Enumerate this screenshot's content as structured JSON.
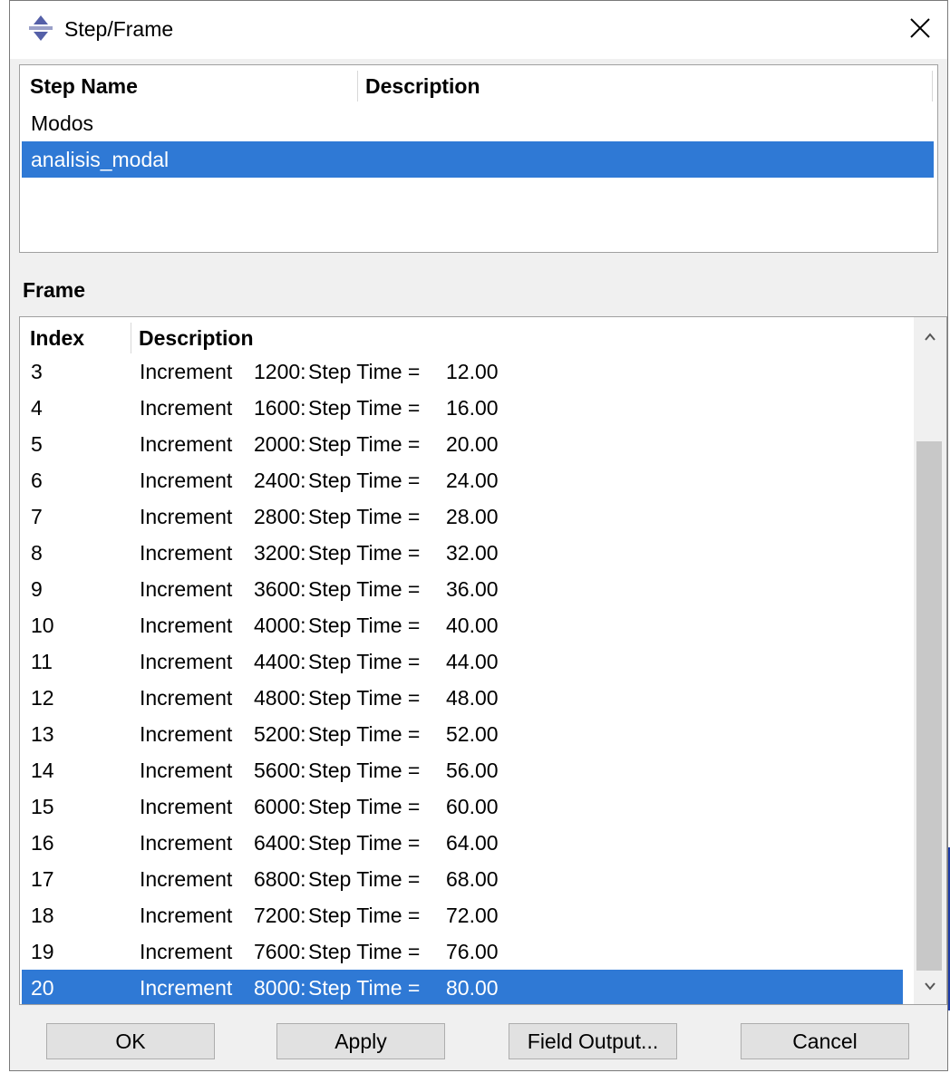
{
  "window": {
    "title": "Step/Frame"
  },
  "step_table": {
    "columns": [
      "Step Name",
      "Description"
    ],
    "rows": [
      {
        "name": "Modos",
        "description": ""
      },
      {
        "name": "analisis_modal",
        "description": ""
      }
    ],
    "selected_row": 1
  },
  "frame_section": {
    "label": "Frame",
    "columns": [
      "Index",
      "Description"
    ],
    "rows": [
      {
        "index": "3",
        "increment": "Increment",
        "number": "1200:",
        "step_time": "Step Time =",
        "value": "12.00"
      },
      {
        "index": "4",
        "increment": "Increment",
        "number": "1600:",
        "step_time": "Step Time =",
        "value": "16.00"
      },
      {
        "index": "5",
        "increment": "Increment",
        "number": "2000:",
        "step_time": "Step Time =",
        "value": "20.00"
      },
      {
        "index": "6",
        "increment": "Increment",
        "number": "2400:",
        "step_time": "Step Time =",
        "value": "24.00"
      },
      {
        "index": "7",
        "increment": "Increment",
        "number": "2800:",
        "step_time": "Step Time =",
        "value": "28.00"
      },
      {
        "index": "8",
        "increment": "Increment",
        "number": "3200:",
        "step_time": "Step Time =",
        "value": "32.00"
      },
      {
        "index": "9",
        "increment": "Increment",
        "number": "3600:",
        "step_time": "Step Time =",
        "value": "36.00"
      },
      {
        "index": "10",
        "increment": "Increment",
        "number": "4000:",
        "step_time": "Step Time =",
        "value": "40.00"
      },
      {
        "index": "11",
        "increment": "Increment",
        "number": "4400:",
        "step_time": "Step Time =",
        "value": "44.00"
      },
      {
        "index": "12",
        "increment": "Increment",
        "number": "4800:",
        "step_time": "Step Time =",
        "value": "48.00"
      },
      {
        "index": "13",
        "increment": "Increment",
        "number": "5200:",
        "step_time": "Step Time =",
        "value": "52.00"
      },
      {
        "index": "14",
        "increment": "Increment",
        "number": "5600:",
        "step_time": "Step Time =",
        "value": "56.00"
      },
      {
        "index": "15",
        "increment": "Increment",
        "number": "6000:",
        "step_time": "Step Time =",
        "value": "60.00"
      },
      {
        "index": "16",
        "increment": "Increment",
        "number": "6400:",
        "step_time": "Step Time =",
        "value": "64.00"
      },
      {
        "index": "17",
        "increment": "Increment",
        "number": "6800:",
        "step_time": "Step Time =",
        "value": "68.00"
      },
      {
        "index": "18",
        "increment": "Increment",
        "number": "7200:",
        "step_time": "Step Time =",
        "value": "72.00"
      },
      {
        "index": "19",
        "increment": "Increment",
        "number": "7600:",
        "step_time": "Step Time =",
        "value": "76.00"
      },
      {
        "index": "20",
        "increment": "Increment",
        "number": "8000:",
        "step_time": "Step Time =",
        "value": "80.00"
      }
    ],
    "selected_index": "20"
  },
  "buttons": {
    "ok": "OK",
    "apply": "Apply",
    "field_output": "Field Output...",
    "cancel": "Cancel"
  },
  "icons": {
    "app": "step-frame-icon",
    "close": "close-icon",
    "scroll_up": "chevron-up-icon",
    "scroll_down": "chevron-down-icon"
  },
  "colors": {
    "selection": "#2f79d5",
    "dialog_bg": "#f0f0f0",
    "button_bg": "#e1e1e1"
  }
}
